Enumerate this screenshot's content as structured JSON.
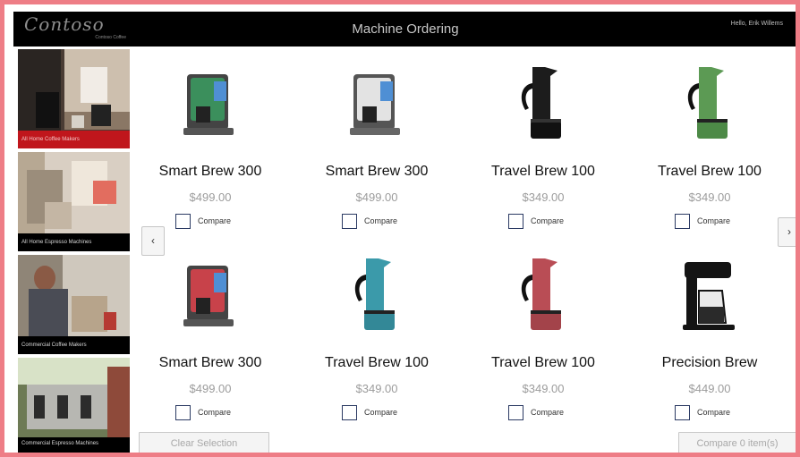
{
  "header": {
    "logo_text": "Contoso",
    "logo_tagline": "Contoso Coffee",
    "title": "Machine Ordering",
    "user_greeting": "Hello, Erik Willems"
  },
  "sidebar": {
    "categories": [
      {
        "label": "All Home Coffee Makers",
        "selected": true
      },
      {
        "label": "All Home Espresso Machines",
        "selected": false
      },
      {
        "label": "Commercial Coffee Makers",
        "selected": false
      },
      {
        "label": "Commercial Espresso Machines",
        "selected": false
      }
    ]
  },
  "products": [
    {
      "name": "Smart Brew 300",
      "price": "$499.00",
      "compare_label": "Compare",
      "color": "#3b8f5c",
      "icon": "drip-coffee-maker-icon"
    },
    {
      "name": "Smart Brew 300",
      "price": "$499.00",
      "compare_label": "Compare",
      "color": "#d9d9d9",
      "icon": "drip-coffee-maker-icon"
    },
    {
      "name": "Travel Brew 100",
      "price": "$349.00",
      "compare_label": "Compare",
      "color": "#1c1c1c",
      "icon": "moka-pot-icon"
    },
    {
      "name": "Travel Brew 100",
      "price": "$349.00",
      "compare_label": "Compare",
      "color": "#5c9a54",
      "icon": "moka-pot-icon"
    },
    {
      "name": "Smart Brew 300",
      "price": "$499.00",
      "compare_label": "Compare",
      "color": "#c8424a",
      "icon": "drip-coffee-maker-icon"
    },
    {
      "name": "Travel Brew 100",
      "price": "$349.00",
      "compare_label": "Compare",
      "color": "#3b9aaa",
      "icon": "moka-pot-icon"
    },
    {
      "name": "Travel Brew 100",
      "price": "$349.00",
      "compare_label": "Compare",
      "color": "#b94d55",
      "icon": "moka-pot-icon"
    },
    {
      "name": "Precision Brew",
      "price": "$449.00",
      "compare_label": "Compare",
      "color": "#141414",
      "icon": "carafe-coffee-maker-icon"
    }
  ],
  "navigation": {
    "prev_glyph": "‹",
    "next_glyph": "›"
  },
  "actions": {
    "clear_label": "Clear Selection",
    "compare_label": "Compare 0 item(s)"
  },
  "colors": {
    "accent_red": "#c0161c",
    "frame_border": "#ee7d86",
    "header_bg": "#000000",
    "checkbox_border": "#2b3a63"
  }
}
